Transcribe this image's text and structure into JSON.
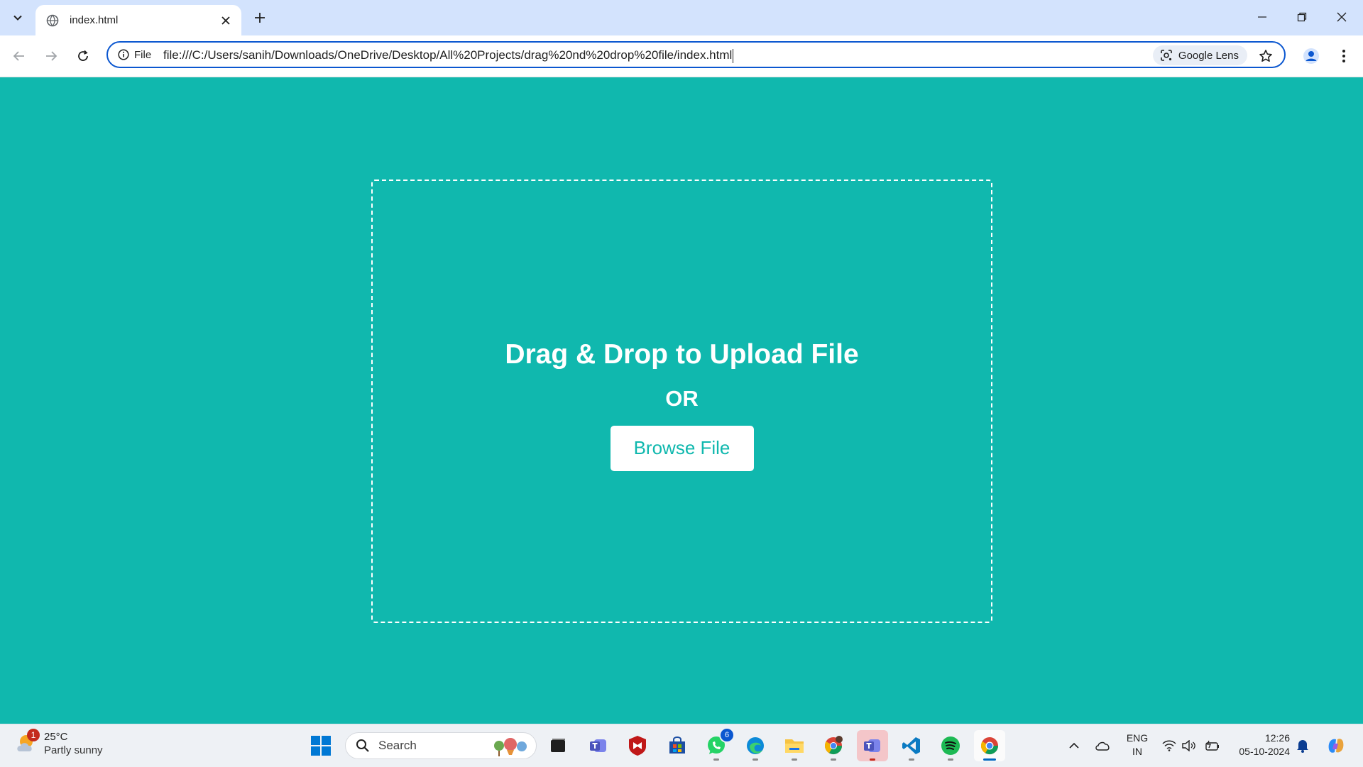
{
  "browser": {
    "tab_title": "index.html",
    "site_chip_label": "File",
    "url": "file:///C:/Users/sanih/Downloads/OneDrive/Desktop/All%20Projects/drag%20nd%20drop%20file/index.html",
    "lens_label": "Google Lens"
  },
  "page": {
    "heading": "Drag & Drop to Upload File",
    "or_text": "OR",
    "browse_button": "Browse File",
    "colors": {
      "background": "#10b8ae",
      "foreground": "#ffffff"
    }
  },
  "taskbar": {
    "weather_temp": "25°C",
    "weather_condition": "Partly sunny",
    "weather_badge": "1",
    "search_placeholder": "Search",
    "whatsapp_badge": "6",
    "lang_line1": "ENG",
    "lang_line2": "IN",
    "time": "12:26",
    "date": "05-10-2024"
  }
}
